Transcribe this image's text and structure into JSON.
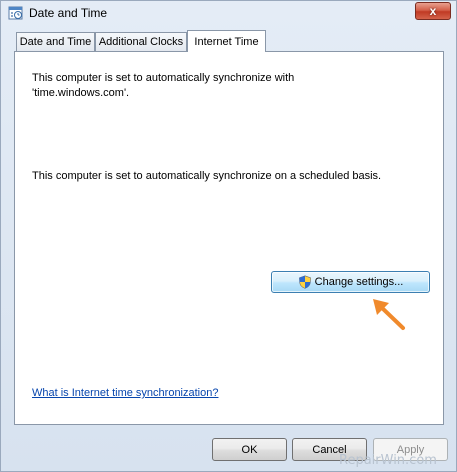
{
  "window": {
    "title": "Date and Time",
    "close_glyph": "x"
  },
  "tabs": [
    {
      "label": "Date and Time"
    },
    {
      "label": "Additional Clocks"
    },
    {
      "label": "Internet Time"
    }
  ],
  "active_tab": "Internet Time",
  "content": {
    "sync_line_1": "This computer is set to automatically synchronize with",
    "sync_line_2": "'time.windows.com'.",
    "schedule_line": "This computer is set to automatically synchronize on a scheduled basis.",
    "change_settings_label": "Change settings...",
    "help_link": "What is Internet time synchronization?"
  },
  "buttons": {
    "ok": "OK",
    "cancel": "Cancel",
    "apply": "Apply"
  },
  "watermark": "RepairWin.com",
  "colors": {
    "annotation_arrow": "#f08a2c",
    "link": "#0645ad"
  },
  "icons": {
    "title": "date-time-icon",
    "shield": "uac-shield-icon",
    "arrow": "annotation-arrow"
  }
}
